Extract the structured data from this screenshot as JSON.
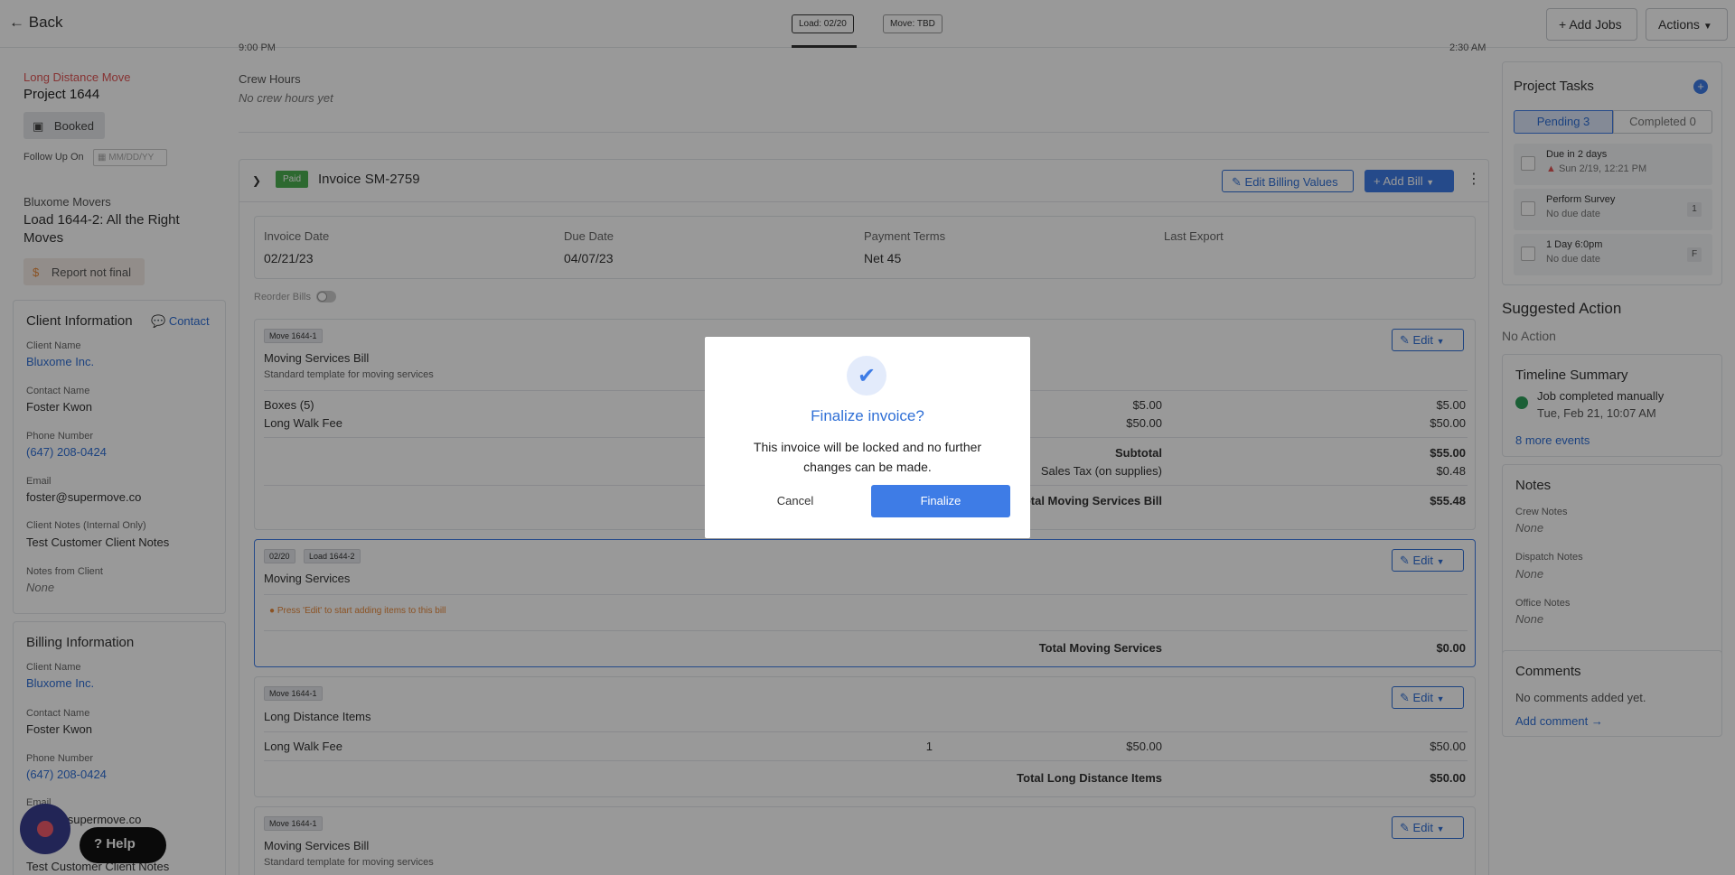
{
  "header": {
    "back_label": "Back",
    "tab_load": "Load: 02/20",
    "tab_move": "Move: TBD",
    "add_jobs": "Add Jobs",
    "actions": "Actions"
  },
  "project": {
    "type": "Long Distance Move",
    "name": "Project 1644",
    "status": "Booked",
    "follow_up_label": "Follow Up On",
    "follow_up_placeholder": "MM/DD/YY",
    "company": "Bluxome Movers",
    "load_title": "Load 1644-2: All the Right Moves",
    "report_status": "Report not final"
  },
  "client_info": {
    "title": "Client Information",
    "contact_link": "Contact",
    "client_name_label": "Client Name",
    "client_name": "Bluxome Inc.",
    "contact_name_label": "Contact Name",
    "contact_name": "Foster Kwon",
    "phone_label": "Phone Number",
    "phone": "(647) 208-0424",
    "email_label": "Email",
    "email": "foster@supermove.co",
    "notes_label": "Client Notes (Internal Only)",
    "notes": "Test Customer Client Notes",
    "from_client_label": "Notes from Client",
    "from_client": "None"
  },
  "billing_info": {
    "title": "Billing Information",
    "client_name_label": "Client Name",
    "client_name": "Bluxome Inc.",
    "contact_name_label": "Contact Name",
    "contact_name": "Foster Kwon",
    "phone_label": "Phone Number",
    "phone": "(647) 208-0424",
    "email_label": "Email",
    "email": "foster@supermove.co",
    "notes": "Test Customer Client Notes"
  },
  "main": {
    "top_time_left": "9:00 PM",
    "top_time_right": "2:30 AM",
    "crew_hours_label": "Crew Hours",
    "crew_hours_value": "No crew hours yet",
    "invoice": {
      "status_badge": "Paid",
      "title": "Invoice SM-2759",
      "edit_billing": "Edit Billing Values",
      "add_bill": "Add Bill",
      "invoice_date_label": "Invoice Date",
      "invoice_date": "02/21/23",
      "due_date_label": "Due Date",
      "due_date": "04/07/23",
      "terms_label": "Payment Terms",
      "terms": "Net 45",
      "last_export_label": "Last Export",
      "reorder_label": "Reorder Bills"
    },
    "edit_label": "Edit",
    "bill1": {
      "tag": "Move 1644-1",
      "title": "Moving Services Bill",
      "subtitle": "Standard template for moving services",
      "items": [
        {
          "name": "Boxes (5)",
          "price": "$5.00",
          "total": "$5.00"
        },
        {
          "name": "Long Walk Fee",
          "price": "$50.00",
          "total": "$50.00"
        }
      ],
      "subtotal_label": "Subtotal",
      "subtotal": "$55.00",
      "tax_label": "Sales Tax (on supplies)",
      "tax": "$0.48",
      "total_label": "Total Moving Services Bill",
      "total": "$55.48"
    },
    "bill2": {
      "tag_date": "02/20",
      "tag_load": "Load 1644-2",
      "title": "Moving Services",
      "hint": "Press 'Edit' to start adding items to this bill",
      "total_label": "Total Moving Services",
      "total": "$0.00"
    },
    "bill3": {
      "tag": "Move 1644-1",
      "title": "Long Distance Items",
      "item_name": "Long Walk Fee",
      "item_qty": "1",
      "item_price": "$50.00",
      "item_total": "$50.00",
      "total_label": "Total Long Distance Items",
      "total": "$50.00"
    },
    "bill4": {
      "tag": "Move 1644-1",
      "title": "Moving Services Bill",
      "subtitle": "Standard template for moving services"
    }
  },
  "right_panel": {
    "tasks_title": "Project Tasks",
    "pending_tab": "Pending 3",
    "completed_tab": "Completed 0",
    "tasks": [
      {
        "title": "Due in 2 days",
        "sub": "Sun 2/19, 12:21 PM",
        "badge": ""
      },
      {
        "title": "Perform Survey",
        "sub": "No due date",
        "badge": "1"
      },
      {
        "title": "1 Day 6:0pm",
        "sub": "No due date",
        "badge": "F"
      }
    ],
    "suggested_title": "Suggested Action",
    "suggested_value": "No Action",
    "timeline_title": "Timeline Summary",
    "timeline_event": "Job completed manually",
    "timeline_time": "Tue, Feb 21, 10:07 AM",
    "more_events": "8 more events",
    "notes_title": "Notes",
    "crew_notes_label": "Crew Notes",
    "crew_notes": "None",
    "dispatch_notes_label": "Dispatch Notes",
    "dispatch_notes": "None",
    "office_notes_label": "Office Notes",
    "office_notes": "None",
    "comments_title": "Comments",
    "comments_empty": "No comments added yet.",
    "add_comment": "Add comment →"
  },
  "help": {
    "label": "Help"
  },
  "modal": {
    "title": "Finalize invoice?",
    "message": "This invoice will be locked and no further changes can be made.",
    "cancel": "Cancel",
    "confirm": "Finalize"
  },
  "colors": {
    "accent": "#3e7ce6",
    "paid_green": "#4caf50",
    "red_label": "#e05555",
    "warning_orange": "#e8893b"
  }
}
